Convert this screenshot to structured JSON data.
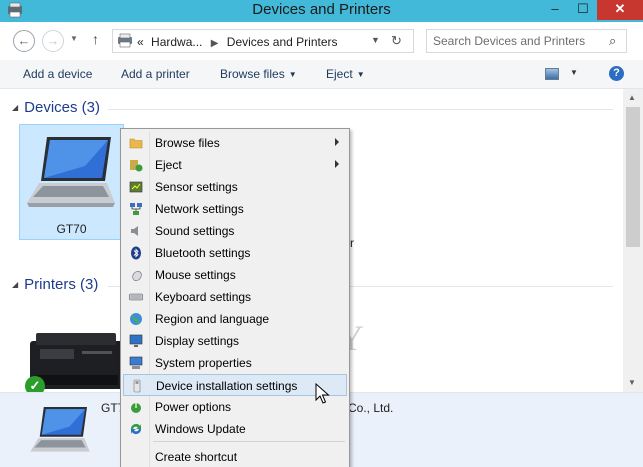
{
  "window": {
    "title": "Devices and Printers",
    "minimize": "–",
    "maximize": "☐",
    "close": "✕"
  },
  "address": {
    "back": "←",
    "forward": "→",
    "up": "↑",
    "crumb_prefix": "«",
    "crumbs": [
      "Hardwa...",
      "Devices and Printers"
    ],
    "separator": "▶",
    "refresh": "↻",
    "search_placeholder": "Search Devices and Printers"
  },
  "commands": {
    "add_device": "Add a device",
    "add_printer": "Add a printer",
    "browse_files": "Browse files",
    "eject": "Eject",
    "help": "?"
  },
  "groups": {
    "devices_header": "Devices (3)",
    "printers_header": "Printers (3)"
  },
  "devices": [
    {
      "label": "GT70",
      "selected": true
    }
  ],
  "background_text": {
    "partial_r": "r",
    "partial_y": "Y"
  },
  "details": {
    "name": "GT7",
    "manufacturer": "Co., Ltd."
  },
  "context_menu": {
    "items": [
      {
        "label": "Browse files",
        "icon": "folder-icon",
        "submenu": true
      },
      {
        "label": "Eject",
        "icon": "eject-icon",
        "submenu": true
      },
      {
        "label": "Sensor settings",
        "icon": "sensor-icon",
        "submenu": false
      },
      {
        "label": "Network settings",
        "icon": "network-icon",
        "submenu": false
      },
      {
        "label": "Sound settings",
        "icon": "speaker-icon",
        "submenu": false
      },
      {
        "label": "Bluetooth settings",
        "icon": "bluetooth-icon",
        "submenu": false
      },
      {
        "label": "Mouse settings",
        "icon": "mouse-icon",
        "submenu": false
      },
      {
        "label": "Keyboard settings",
        "icon": "keyboard-icon",
        "submenu": false
      },
      {
        "label": "Region and language",
        "icon": "globe-icon",
        "submenu": false
      },
      {
        "label": "Display settings",
        "icon": "display-icon",
        "submenu": false
      },
      {
        "label": "System properties",
        "icon": "computer-icon",
        "submenu": false
      },
      {
        "label": "Device installation settings",
        "icon": "usb-icon",
        "submenu": false,
        "highlighted": true
      },
      {
        "label": "Power options",
        "icon": "power-icon",
        "submenu": false
      },
      {
        "label": "Windows Update",
        "icon": "update-icon",
        "submenu": false
      },
      {
        "label": "Create shortcut",
        "icon": "",
        "submenu": false
      }
    ]
  },
  "colors": {
    "titlebar": "#42b9d8",
    "close_button": "#c7372f",
    "group_header": "#1e3c8c",
    "selection": "#cce8ff",
    "menu_highlight": "#dde9f5"
  }
}
